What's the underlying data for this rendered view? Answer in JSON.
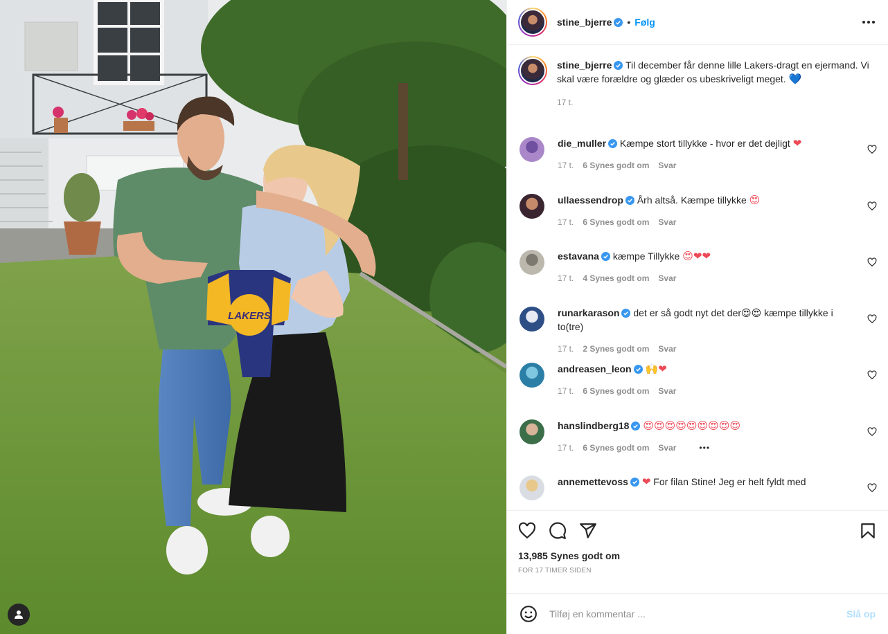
{
  "colors": {
    "accent": "#0095f6",
    "muted": "#8e8e8e",
    "heart": "#ed4956"
  },
  "header": {
    "username": "stine_bjerre",
    "separator": "•",
    "follow_label": "Følg",
    "more_icon": "more-horizontal-icon"
  },
  "caption": {
    "username": "stine_bjerre",
    "text": "Til december får denne lille Lakers-dragt en ejermand. Vi skal være forældre og glæder os ubeskriveligt meget.",
    "emoji": "💙",
    "time": "17 t."
  },
  "comments": [
    {
      "username": "die_muller",
      "text": "Kæmpe stort tillykke - hvor er det dejligt",
      "emoji": "❤",
      "time": "17 t.",
      "likes": "6 Synes godt om",
      "reply": "Svar"
    },
    {
      "username": "ullaessendrop",
      "text": "Årh altså. Kæmpe tillykke",
      "emoji": "😍",
      "time": "17 t.",
      "likes": "6 Synes godt om",
      "reply": "Svar"
    },
    {
      "username": "estavana",
      "text": "kæmpe Tillykke",
      "emoji": "😍❤❤",
      "time": "17 t.",
      "likes": "4 Synes godt om",
      "reply": "Svar"
    },
    {
      "username": "runarkarason",
      "text": "det er så godt nyt det der😍😍 kæmpe tillykke i to(tre)",
      "emoji": "",
      "time": "17 t.",
      "likes": "2 Synes godt om",
      "reply": "Svar"
    },
    {
      "username": "andreasen_leon",
      "text": "",
      "emoji": "🙌❤",
      "time": "17 t.",
      "likes": "6 Synes godt om",
      "reply": "Svar"
    },
    {
      "username": "hanslindberg18",
      "text": "",
      "emoji": "😍😍😍😍😍😍😍😍😍",
      "time": "17 t.",
      "likes": "6 Synes godt om",
      "reply": "Svar",
      "more": "•••"
    },
    {
      "username": "annemettevoss",
      "text": "For filan Stine! Jeg er helt fyldt med",
      "emoji": "❤",
      "time": "",
      "likes": "",
      "reply": ""
    }
  ],
  "actions": {
    "like_icon": "heart-icon",
    "comment_icon": "comment-icon",
    "share_icon": "share-icon",
    "save_icon": "bookmark-icon",
    "likes_total": "13,985 Synes godt om",
    "posted": "FOR 17 TIMER SIDEN"
  },
  "add_comment": {
    "placeholder": "Tilføj en kommentar ...",
    "post_label": "Slå op"
  },
  "photo": {
    "jersey_text": "LAKERS",
    "user_tag_icon": "user-tag-icon"
  }
}
